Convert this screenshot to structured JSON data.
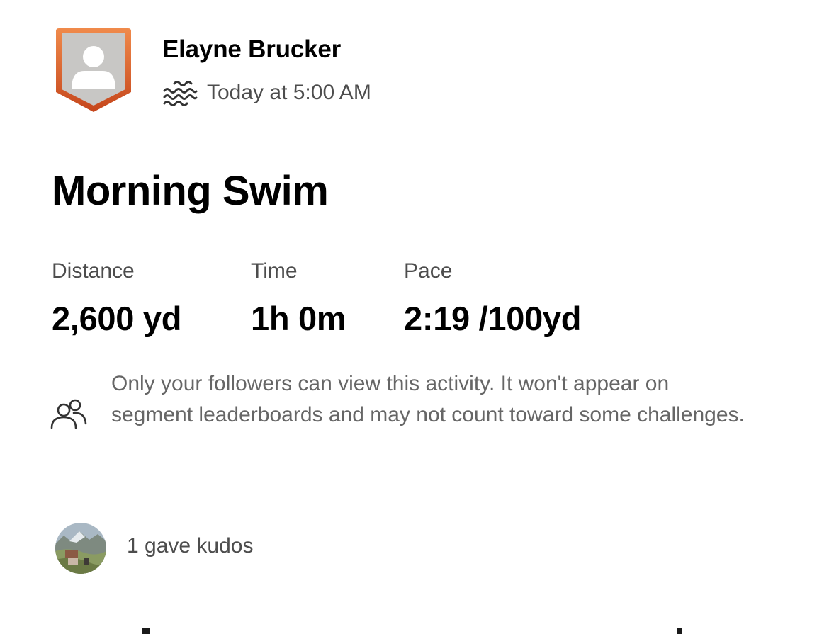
{
  "header": {
    "athlete_name": "Elayne Brucker",
    "sport_icon": "swim-icon",
    "timestamp": "Today at 5:00 AM",
    "avatar_icon": "person-placeholder-icon"
  },
  "activity": {
    "title": "Morning Swim",
    "stats": [
      {
        "label": "Distance",
        "value": "2,600 yd"
      },
      {
        "label": "Time",
        "value": "1h 0m"
      },
      {
        "label": "Pace",
        "value": "2:19 /100yd"
      }
    ]
  },
  "privacy": {
    "icon": "followers-icon",
    "message": "Only your followers can view this activity. It won't appear on segment leaderboards and may not count toward some challenges."
  },
  "kudos": {
    "text": "1 gave kudos"
  },
  "colors": {
    "badge_orange_light": "#f08a4b",
    "badge_orange_dark": "#c5461c",
    "avatar_gray": "#c8c7c5",
    "primary_text": "#000000",
    "secondary_text": "#4d4d4d",
    "muted_text": "#666666"
  }
}
